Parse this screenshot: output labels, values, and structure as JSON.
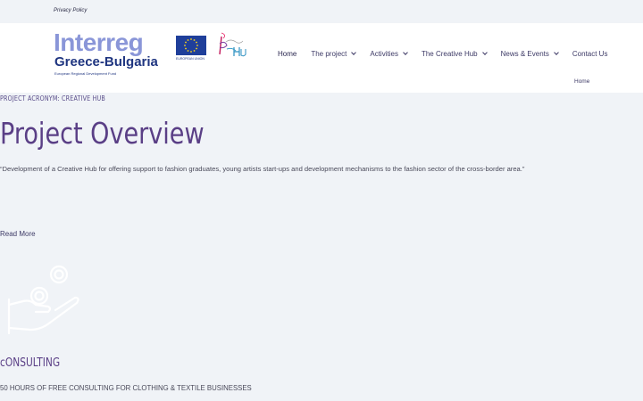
{
  "topbar": {
    "privacy_link": "Privacy Policy"
  },
  "logo": {
    "interreg": "Interreg",
    "region": "Greece-Bulgaria",
    "fund": "European Regional Development Fund",
    "eu_label": "EUROPEAN UNION"
  },
  "nav": {
    "items": [
      {
        "label": "Home",
        "has_dropdown": false
      },
      {
        "label": "The project",
        "has_dropdown": true
      },
      {
        "label": "Activities",
        "has_dropdown": true
      },
      {
        "label": "The Creative Hub",
        "has_dropdown": true
      },
      {
        "label": "News & Events",
        "has_dropdown": true
      },
      {
        "label": "Contact Us",
        "has_dropdown": false
      }
    ]
  },
  "breadcrumb": "Home",
  "main": {
    "acronym": "PROJECT ACRONYM: CREATIVE HUB",
    "title": "Project Overview",
    "description": "“Development of a Creative Hub for offering support to fashion graduates, young artists start-ups and development mechanisms to the fashion sector of the cross-border area.”",
    "read_more": "Read More"
  },
  "service": {
    "title": "cONSULTING",
    "subtitle": "50 HOURS OF FREE CONSULTING FOR CLOTHING & TEXTILE BUSINESSES"
  },
  "colors": {
    "page_bg": "#f0f3f7",
    "heading": "#5a3f86",
    "nav_text": "#3d3a66",
    "interreg_blue": "#8a96d8",
    "eu_blue": "#1f3f9a"
  }
}
